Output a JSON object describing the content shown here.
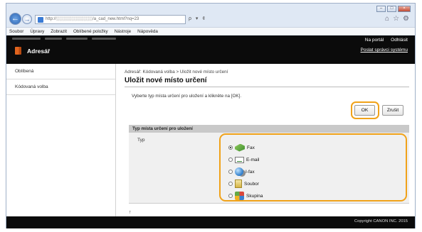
{
  "browser": {
    "address": "http://░░░░░░░░░░░░/a_cad_new.html?nq=23",
    "address_tools": "ρ ▾ ¢",
    "window_buttons": [
      "–",
      "□",
      "×"
    ]
  },
  "menu": [
    "Soubor",
    "Úpravy",
    "Zobrazit",
    "Oblíbené položky",
    "Nástroje",
    "Nápověda"
  ],
  "header": {
    "app_title": "Adresář",
    "portal_link": "Na portál",
    "logout_link": "Odhlásit",
    "admin_link": "Poslat správci systému"
  },
  "sidebar": {
    "items": [
      {
        "label": "Oblíbená"
      },
      {
        "label": "Kódovaná volba"
      }
    ]
  },
  "main": {
    "breadcrumb": "Adresář: Kódovaná volba > Uložit nové místo určení",
    "title": "Uložit nové místo určení",
    "instruction": "Vyberte typ místa určení pro uložení a klikněte na [OK].",
    "ok_label": "OK",
    "cancel_label": "Zrušit",
    "section_title": "Typ místa určení pro uložení",
    "type_label": "Typ",
    "options": [
      {
        "label": "Fax",
        "icon": "fax-icon",
        "selected": true
      },
      {
        "label": "E-mail",
        "icon": "email-icon",
        "selected": false
      },
      {
        "label": "I-fax",
        "icon": "ifax-icon",
        "selected": false
      },
      {
        "label": "Soubor",
        "icon": "file-icon",
        "selected": false
      },
      {
        "label": "Skupina",
        "icon": "group-icon",
        "selected": false
      }
    ],
    "top_glyph": "↑"
  },
  "footer": {
    "copyright": "Copyright CANON INC. 2015"
  },
  "colors": {
    "highlight_ring": "#f0a219",
    "header_bg": "#0b0b0b"
  }
}
